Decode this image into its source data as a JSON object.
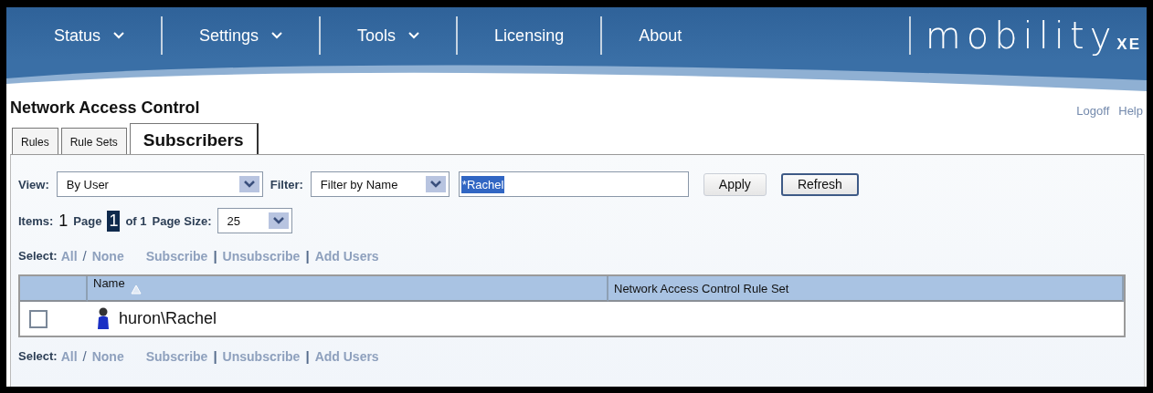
{
  "nav": [
    {
      "label": "Status",
      "dropdown": true
    },
    {
      "label": "Settings",
      "dropdown": true
    },
    {
      "label": "Tools",
      "dropdown": true
    },
    {
      "label": "Licensing",
      "dropdown": false
    },
    {
      "label": "About",
      "dropdown": false
    }
  ],
  "logo": {
    "name": "mobility",
    "suffix": "XE"
  },
  "page_title": "Network Access Control",
  "header_links": [
    "Logoff",
    "Help"
  ],
  "tabs": [
    {
      "label": "Rules",
      "selected": false
    },
    {
      "label": "Rule Sets",
      "selected": false
    },
    {
      "label": "Subscribers",
      "selected": true
    }
  ],
  "filters": {
    "view_label": "View:",
    "view_value": "By User",
    "filter_label": "Filter:",
    "filter_value": "Filter by Name",
    "search_value": "*Rachel",
    "search_text_selected": true,
    "buttons": [
      {
        "label": "Apply",
        "default": false
      },
      {
        "label": "Refresh",
        "default": true
      }
    ]
  },
  "paging": {
    "items_label": "Items:",
    "items_count": "1",
    "page_label": "Page",
    "page_current": "1",
    "page_of": "of 1",
    "page_size_label": "Page Size:",
    "page_size": "25"
  },
  "select_bars": [
    {
      "label": "Select:",
      "all": "All",
      "separator": "/",
      "none": "None",
      "actions": [
        "Subscribe",
        "Unsubscribe",
        "Add Users"
      ],
      "action_separator": "|"
    },
    {
      "label": "Select:",
      "all": "All",
      "separator": "/",
      "none": "None",
      "actions": [
        "Subscribe",
        "Unsubscribe",
        "Add Users"
      ],
      "action_separator": "|"
    }
  ],
  "table": {
    "columns": [
      {
        "label": "Name",
        "sorted": true
      },
      {
        "label": "Network Access Control Rule Set",
        "sorted": false
      }
    ],
    "rows": [
      {
        "kind": "user",
        "checked": false,
        "name": "huron\\Rachel"
      }
    ]
  }
}
